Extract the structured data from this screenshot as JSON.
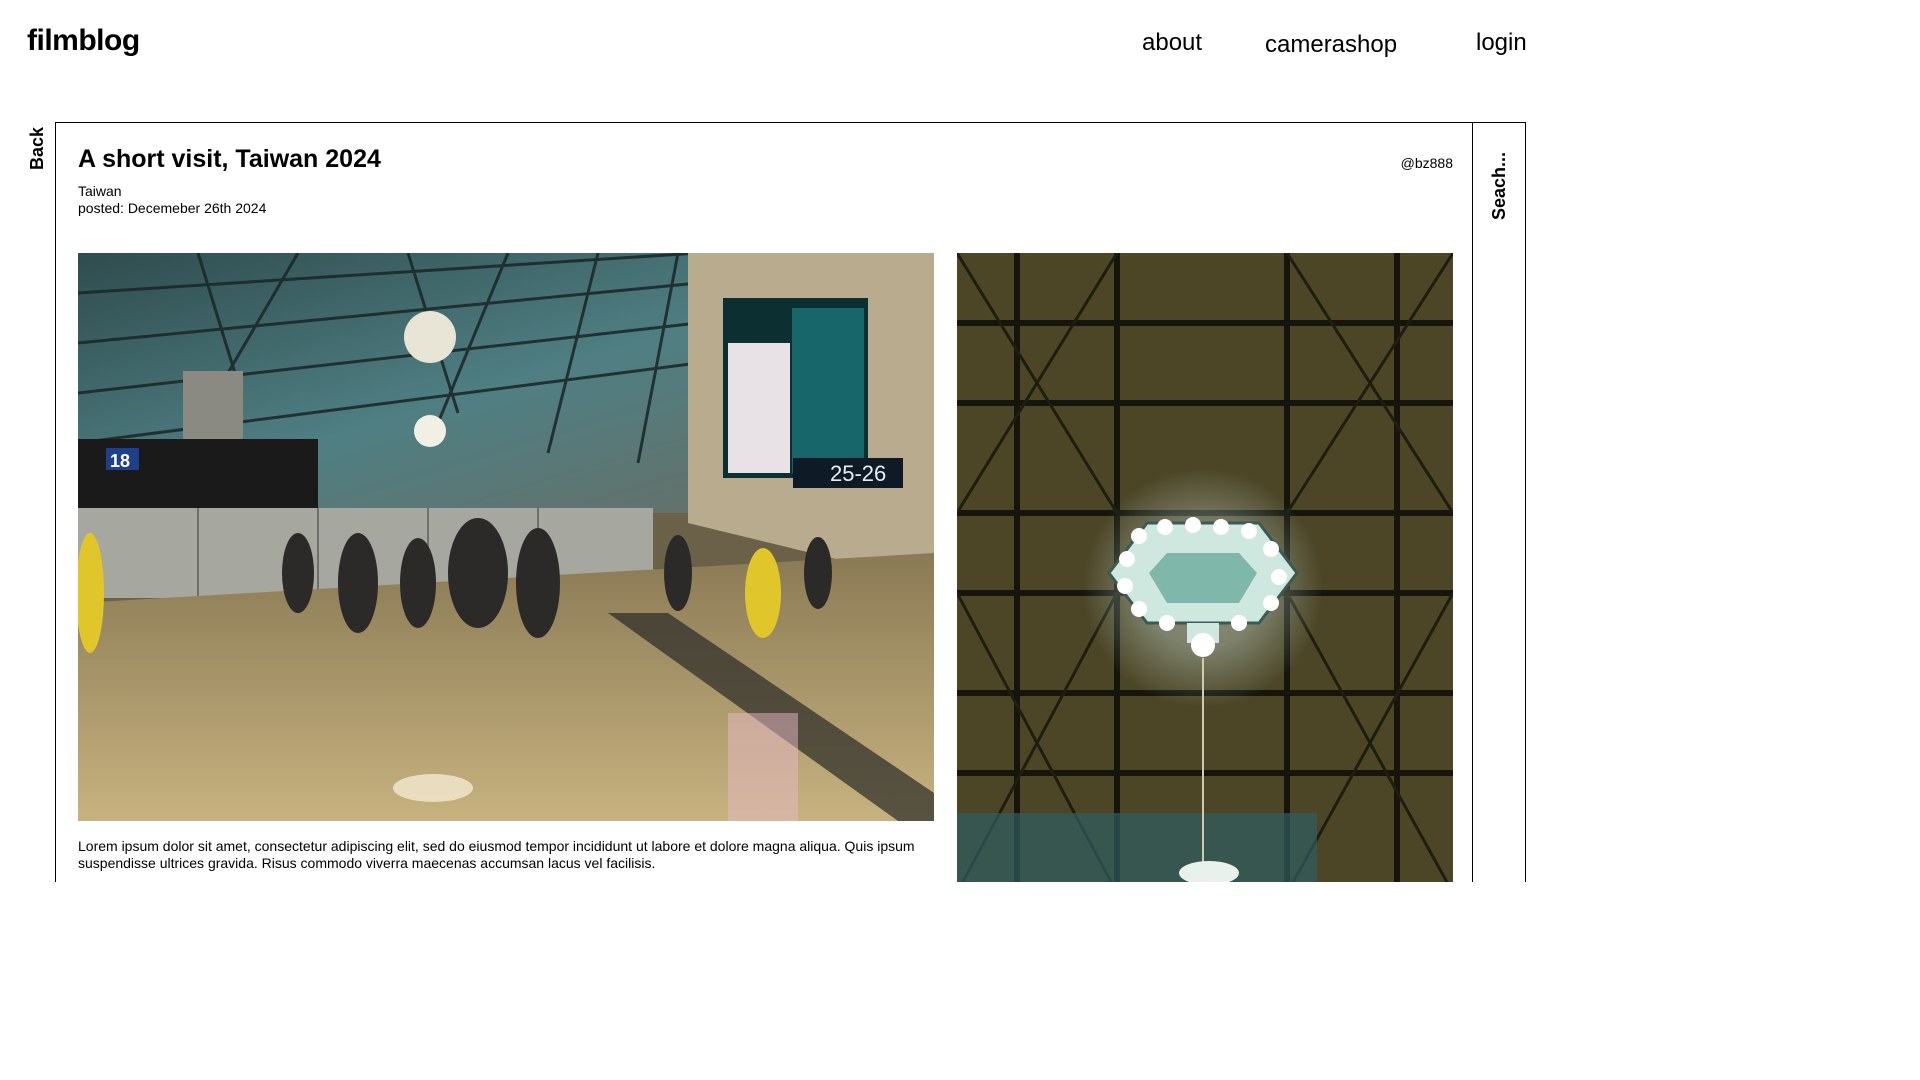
{
  "brand": "filmblog",
  "nav": {
    "about": "about",
    "camerashop": "camerashop",
    "login": "login"
  },
  "side": {
    "back": "Back",
    "search": "Seach..."
  },
  "post": {
    "title": "A short visit, Taiwan 2024",
    "location": "Taiwan",
    "posted": "posted: Decemeber 26th 2024",
    "author": "@bz888",
    "caption": "Lorem ipsum dolor sit amet, consectetur adipiscing elit, sed do eiusmod tempor incididunt ut labore et dolore magna aliqua. Quis ipsum suspendisse ultrices gravida. Risus commodo viverra maecenas accumsan lacus vel facilisis."
  },
  "photos": {
    "main_signs": {
      "gate": "18",
      "gates_range": "25-26"
    }
  }
}
